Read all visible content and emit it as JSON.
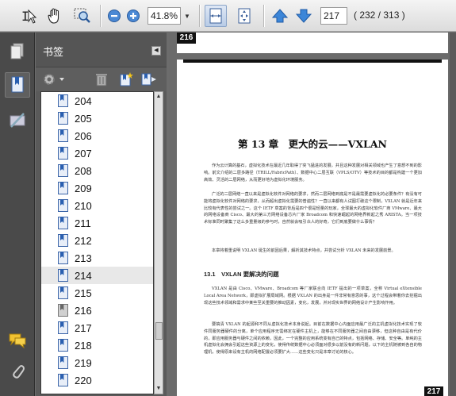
{
  "toolbar": {
    "zoom_value": "41.8%",
    "page_value": "217",
    "page_count": "( 232 / 313 )",
    "icons": [
      "text-select-icon",
      "hand-icon",
      "zoom-marquee-icon",
      "zoom-out-icon",
      "zoom-in-icon",
      "fit-width-icon",
      "fit-page-icon",
      "previous-page-icon",
      "next-page-icon"
    ]
  },
  "rail": {
    "icons": [
      "pages-icon",
      "bookmarks-icon",
      "signatures-icon",
      "comments-icon",
      "attachments-icon"
    ]
  },
  "panel": {
    "title": "书签",
    "tool_icons": [
      "options-gear-icon",
      "delete-icon",
      "new-bookmark-icon",
      "expand-bookmark-icon"
    ]
  },
  "bookmarks": [
    {
      "label": "204"
    },
    {
      "label": "205"
    },
    {
      "label": "206"
    },
    {
      "label": "207"
    },
    {
      "label": "208"
    },
    {
      "label": "209"
    },
    {
      "label": "210"
    },
    {
      "label": "211"
    },
    {
      "label": "212"
    },
    {
      "label": "213"
    },
    {
      "label": "214"
    },
    {
      "label": "215"
    },
    {
      "label": "216"
    },
    {
      "label": "217"
    },
    {
      "label": "218"
    },
    {
      "label": "219"
    },
    {
      "label": "220"
    }
  ],
  "selected_bookmark": "214",
  "document": {
    "prev_page_number": "216",
    "page_number": "217",
    "chapter_title": "第 13 章　更大的云——VXLAN",
    "intro_paragraphs": [
      "作为云计算的基石，虚拟化技术在最近几年取得了突飞猛进的发展，并且这种发展对相关领域也产生了意想不到的影响。前文介绍的二层多路径（TRILL/FabricPath）、数据中心二层互联（VPLS/OTV）等技术的目的都是构建一个更加高效、灵活的二层网络，从而更好地为虚拟化环境服务。",
      "广泛的二层网络一直以来是虚拟化软件对网络的要求，然而二层网络到底是不是最需要虚拟化的必要条件？有没有可能将虚拟化软件对网络的要求，从而超出虚拟化需要的普遍性？一直以来都有人试图打破这个限制，VXLAN 就是近年来比较有代表性的尝试之一。这个 IETF 草案的背后是四个很是轻量的玩家，全球最大的虚拟化软件厂商 VMware、最大的网络设备商 Cisco、最大的第三方网络设备芯片厂家 Broadcom 和快速崛起的网络界新起之秀 ARISTA。当一项技术标准同时聚集了这么多重量级的参与时，自然就会吸引众人的好奇，它们到底要做什么事情？",
      "本章将着重说明 VXLAN 诞生的前因后果，解析其技术特点，并尝试分析 VXLAN 未来的发展前景。"
    ],
    "section_title": "13.1　VXLAN 要解决的问题",
    "section_paragraphs": [
      "VXLAN 是由 Cisco、VMware、Broadcom 等厂家联合向 IETF 提出的一项草案，全称 Virtual eXtensible Local Area Network，即虚拟扩展局域网。根据 VXLAN 的出身是一件非常有意思的事，这个过程会带着你去挖掘出现这些技术领域和需求中某些至关重要的推动因素，变化，发展，并对现实世界的网络设计产生影响作用。",
      "要搞清 VXLAN 的起源和不同从虚拟化技术本身说起。目前在数据中心内面应用最广泛的主机虚拟化技术实现了软件同服务器硬件的分离，单个应用程序无需绑定在硬件主机上，能够在不同服务器之间自由漂移，但这种自由是有代价的，即应用服务器与硬件之间的依赖，因此，一个完整的应用系统变有自己的特点，包括网络、存储、安全等。单纯的主机虚拟化会拥会引起这些资源上的变化，使得传统数据中心必须面对很多以前没有的新问题，以下的主机随被到各自的物理机，使得原来设有主机的网络配置必须要扩大……这些变化只是本章讨论的核心。"
    ]
  }
}
